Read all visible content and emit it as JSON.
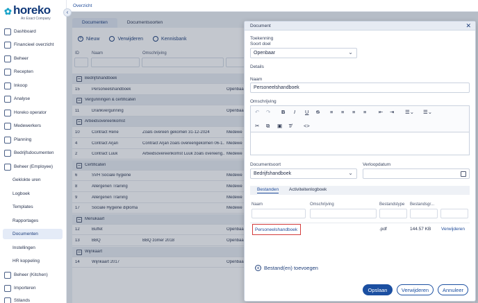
{
  "brand": {
    "name": "horeko",
    "subtitle": "An Exact Company"
  },
  "sidebar": {
    "items": [
      {
        "label": "Dashboard"
      },
      {
        "label": "Financieel overzicht"
      },
      {
        "label": "Beheer"
      },
      {
        "label": "Recepten"
      },
      {
        "label": "Inkoop"
      },
      {
        "label": "Analyse"
      },
      {
        "label": "Horeko operator"
      },
      {
        "label": "Medewerkers"
      },
      {
        "label": "Planning"
      },
      {
        "label": "Bedrijfsdocumenten"
      },
      {
        "label": "Beheer (Employee)"
      },
      {
        "label": "Geklokte uren"
      },
      {
        "label": "Logboek"
      },
      {
        "label": "Templates"
      },
      {
        "label": "Rapportages"
      },
      {
        "label": "Documenten"
      },
      {
        "label": "Instellingen"
      },
      {
        "label": "HR koppeling"
      },
      {
        "label": "Beheer (Kitchen)"
      },
      {
        "label": "Importeren"
      },
      {
        "label": "Stilands"
      }
    ]
  },
  "topbar": {
    "breadcrumb": "Overzicht"
  },
  "main": {
    "tabs": [
      "Documenten",
      "Documentsoorten"
    ],
    "toolbar": {
      "new": "Nieuw",
      "delete": "Verwijderen",
      "knowledge": "Kennisbank"
    },
    "columns": {
      "id": "ID",
      "name": "Naam",
      "description": "Omschrijving"
    },
    "rows": [
      {
        "group": "Bedrijfshandboek"
      },
      {
        "id": "15",
        "name": "Personeelshandboek",
        "desc": "",
        "rest": "Openbaar"
      },
      {
        "group": "Vergunningen & certificaten"
      },
      {
        "id": "11",
        "name": "Drankvergunning",
        "desc": "",
        "rest": "Openbaar"
      },
      {
        "group": "Arbeidsovereenkomst"
      },
      {
        "id": "10",
        "name": "Contract Rene",
        "desc": "Zoals overeen gekomen 31-12-2024",
        "rest": "Medewe"
      },
      {
        "id": "4",
        "name": "Contract Arjan",
        "desc": "Contract Arjan zoals overeengekomen 06-1...",
        "rest": "Medewe"
      },
      {
        "id": "2",
        "name": "Contract Luuk",
        "desc": "Arbeidsovereenkomst Luuk zoals overeeng...",
        "rest": "Medewe"
      },
      {
        "group": "Certificaten"
      },
      {
        "id": "6",
        "name": "SVH Sociale hygiëne",
        "desc": "",
        "rest": "Medewe"
      },
      {
        "id": "8",
        "name": "Allergenen Training",
        "desc": "",
        "rest": "Medewe"
      },
      {
        "id": "9",
        "name": "Allergenen Training",
        "desc": "",
        "rest": "Medewe"
      },
      {
        "id": "17",
        "name": "Sociale Hygiëne diploma",
        "desc": "",
        "rest": "Medewe"
      },
      {
        "group": "Menukaart"
      },
      {
        "id": "12",
        "name": "Buffet",
        "desc": "",
        "rest": "Openbaar"
      },
      {
        "id": "13",
        "name": "BBQ",
        "desc": "BBQ zomer 2018",
        "rest": "Openbaar"
      },
      {
        "group": "Wijnkaart"
      },
      {
        "id": "14",
        "name": "Wijnkaart 2017",
        "desc": "",
        "rest": "Openbaar"
      }
    ]
  },
  "dialog": {
    "title": "Document",
    "section_access": "Toekenning",
    "target_type_label": "Soort doel",
    "target_type_value": "Openbaar",
    "section_details": "Details",
    "name_label": "Naam",
    "name_value": "Personeelshandboek",
    "description_label": "Omschrijving",
    "doctype_label": "Documentsoort",
    "doctype_value": "Bedrijfshandboek",
    "expiry_label": "Verloopdatum",
    "expiry_value": "",
    "subtabs": [
      "Bestanden",
      "Activiteitenlogboek"
    ],
    "files_columns": [
      "Naam",
      "Omschrijving",
      "Bestandstype",
      "Bestandsgr..."
    ],
    "file": {
      "name": "Personeelshandboek",
      "desc": "",
      "type": ".pdf",
      "size": "144.57 KB",
      "action": "Verwijderen"
    },
    "add_files": "Bestand(en) toevoegen",
    "buttons": {
      "save": "Opslaan",
      "delete": "Verwijderen",
      "cancel": "Annuleer"
    }
  },
  "colors": {
    "primary": "#1b4fa1",
    "brand": "#123a7a",
    "highlight": "#d33b3b"
  }
}
